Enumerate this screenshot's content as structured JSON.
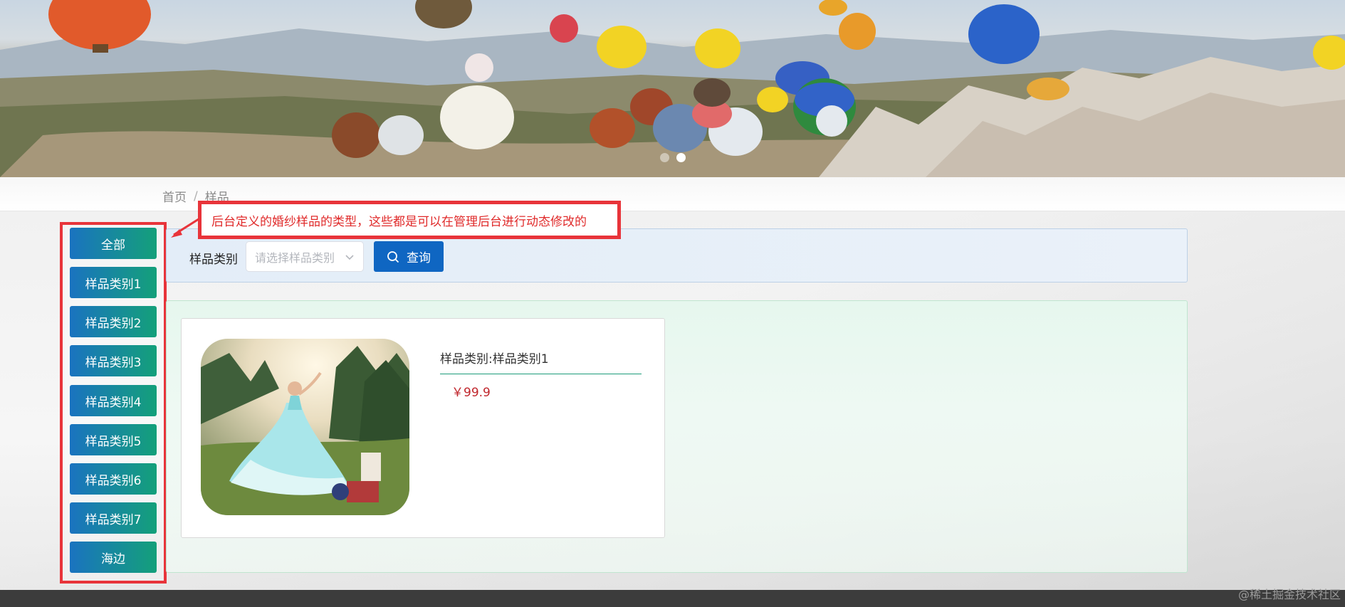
{
  "breadcrumb": {
    "home": "首页",
    "separator": "/",
    "current": "样品"
  },
  "carousel": {
    "slide_count": 2,
    "active_index": 1
  },
  "annotation": {
    "text": "后台定义的婚纱样品的类型，这些都是可以在管理后台进行动态修改的"
  },
  "categories": [
    {
      "label": "全部"
    },
    {
      "label": "样品类别1"
    },
    {
      "label": "样品类别2"
    },
    {
      "label": "样品类别3"
    },
    {
      "label": "样品类别4"
    },
    {
      "label": "样品类别5"
    },
    {
      "label": "样品类别6"
    },
    {
      "label": "样品类别7"
    },
    {
      "label": "海边"
    }
  ],
  "search": {
    "label": "样品类别",
    "select_placeholder": "请选择样品类别",
    "query_label": "查询"
  },
  "products": [
    {
      "type_text": "样品类别:样品类别1",
      "price": "￥99.9"
    }
  ],
  "watermark": "@稀土掘金技术社区",
  "colors": {
    "annotation_red": "#e8343a",
    "category_gradient_start": "#1a73c0",
    "category_gradient_end": "#14a07a",
    "query_blue": "#0f66c2",
    "price_red": "#c0262c"
  },
  "icons": {
    "search": "search-icon",
    "select_arrow": "chevron-down-icon",
    "callout_arrow": "arrow-icon"
  }
}
